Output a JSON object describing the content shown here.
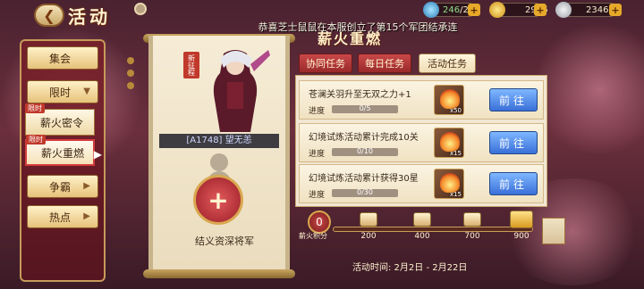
{
  "header": {
    "back_icon": "back-arrow-icon",
    "title": "活动",
    "settings_icon": "gear-icon"
  },
  "resources": [
    {
      "icon": "energy-icon",
      "value": "246",
      "max": "/240",
      "plus": "+"
    },
    {
      "icon": "gold-ingot-icon",
      "value": "2936",
      "plus": "+"
    },
    {
      "icon": "silver-coin-icon",
      "value": "234600",
      "plus": "+"
    }
  ],
  "announcement": "恭喜芝士鼠鼠在本服创立了第15个军团结承连",
  "menu": {
    "items": [
      {
        "label": "集会",
        "arrow": ""
      },
      {
        "label": "限时",
        "arrow": "▼"
      },
      {
        "label": "争霸",
        "arrow": "▶"
      },
      {
        "label": "热点",
        "arrow": "▶"
      }
    ],
    "sub_items": [
      {
        "label": "薪火密令",
        "tag": "限时"
      },
      {
        "label": "薪火重燃",
        "tag": "限时",
        "arrow": "▶"
      }
    ]
  },
  "hero": {
    "new_tag": "新征程",
    "name": "[A1748] 望无恙",
    "pledge_plus": "+",
    "pledge_label": "结义资深将军"
  },
  "panel": {
    "title": "薪火重燃",
    "tabs": [
      "协同任务",
      "每日任务",
      "活动任务"
    ],
    "active_tab": "活动任务"
  },
  "tasks": [
    {
      "title": "苍澜关羽升至无双之力+1",
      "progress_label": "进度",
      "progress_text": "0/5",
      "progress": 0.0,
      "reward_count": "x50",
      "button": "前往"
    },
    {
      "title": "幻境试炼活动累计完成10关",
      "progress_label": "进度",
      "progress_text": "0/10",
      "progress": 0.0,
      "reward_count": "x15",
      "button": "前往"
    },
    {
      "title": "幻境试炼活动累计获得30星",
      "progress_label": "进度",
      "progress_text": "0/30",
      "progress": 0.0,
      "reward_count": "x15",
      "button": "前往"
    }
  ],
  "points": {
    "value": "0",
    "label": "薪火积分",
    "milestones": [
      "200",
      "400",
      "700",
      "900"
    ]
  },
  "activity_time": "活动时间: 2月2日 - 2月22日",
  "colors": {
    "accent_red": "#c94848",
    "go_button": "#3a6fd8",
    "gold": "#d9a850"
  }
}
